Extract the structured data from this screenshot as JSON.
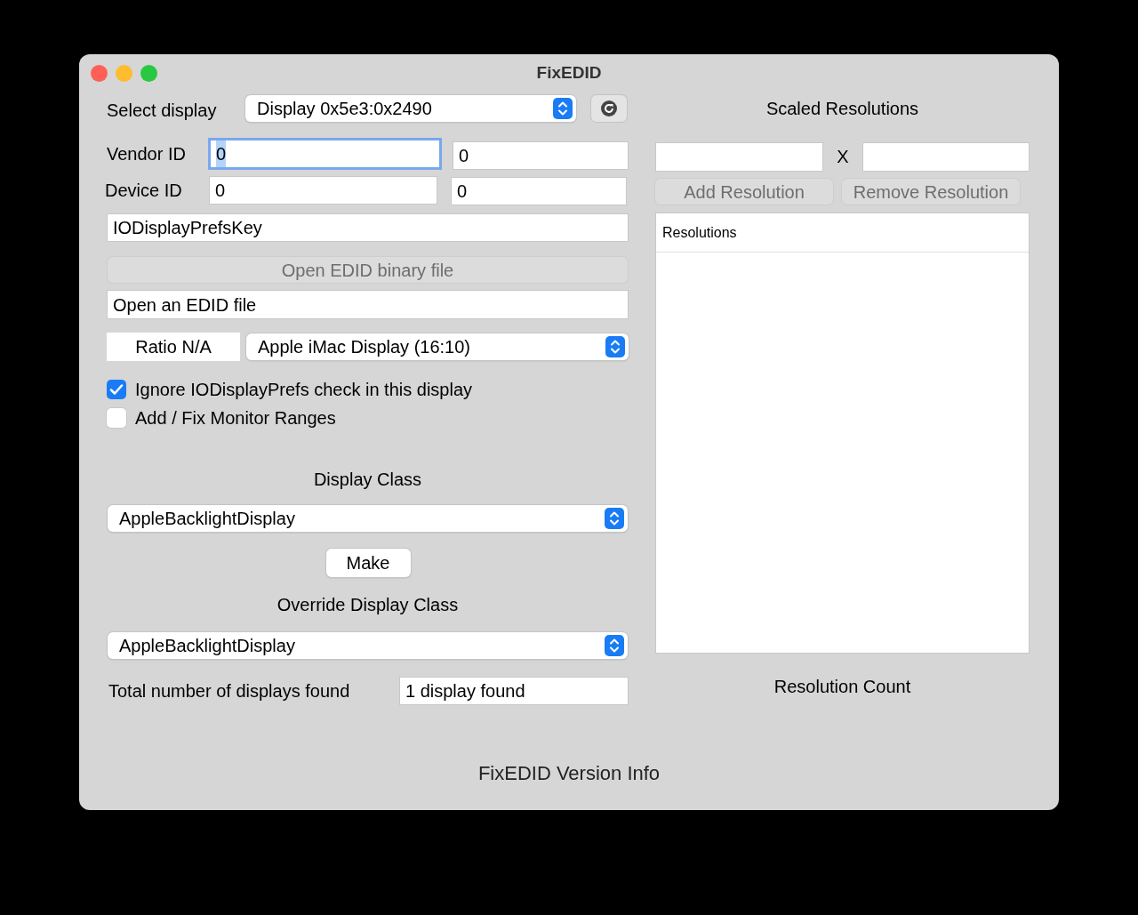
{
  "window": {
    "title": "FixEDID"
  },
  "select_display": {
    "label": "Select display",
    "value": "Display 0x5e3:0x2490"
  },
  "vendor_id": {
    "label": "Vendor ID",
    "value": "0",
    "value_2": "0",
    "focused": true
  },
  "device_id": {
    "label": "Device ID",
    "value": "0",
    "value_2": "0"
  },
  "prefs_key": {
    "value": "IODisplayPrefsKey"
  },
  "open_button": {
    "label": "Open EDID binary file",
    "disabled": true
  },
  "edid_file": {
    "value": "Open an EDID file"
  },
  "ratio": {
    "label": "Ratio N/A"
  },
  "preset": {
    "value": "Apple iMac Display (16:10)"
  },
  "checkboxes": [
    {
      "label": "Ignore IODisplayPrefs check in this display",
      "checked": true
    },
    {
      "label": "Add / Fix Monitor Ranges",
      "checked": false
    }
  ],
  "display_class": {
    "label": "Display Class",
    "value": "AppleBacklightDisplay"
  },
  "make_button": {
    "label": "Make"
  },
  "override_class": {
    "label": "Override Display Class",
    "value": "AppleBacklightDisplay"
  },
  "total": {
    "label": "Total number of displays found",
    "value": "1 display found"
  },
  "scaled": {
    "title": "Scaled Resolutions",
    "separator": "X",
    "buttons": [
      {
        "label": "Add Resolution",
        "disabled": true
      },
      {
        "label": "Remove Resolution",
        "disabled": true
      }
    ],
    "list_header": "Resolutions",
    "count_label": "Resolution Count"
  },
  "version": "FixEDID Version Info"
}
